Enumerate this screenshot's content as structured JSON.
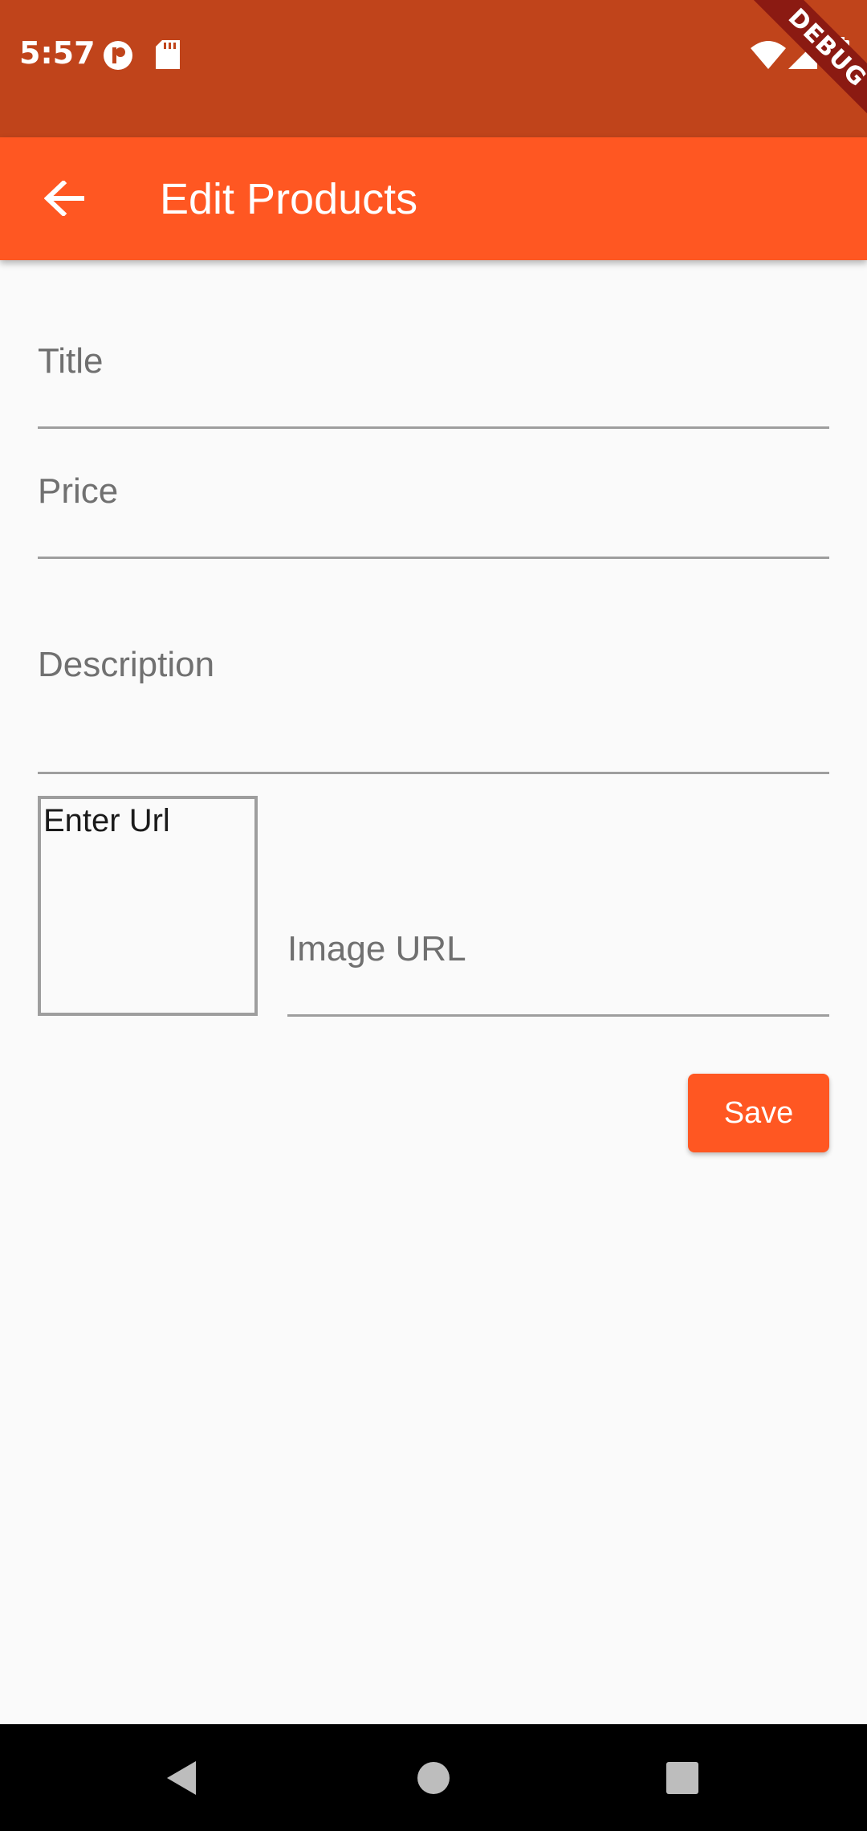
{
  "status_bar": {
    "time": "5:57",
    "badge_text": "DEBUG",
    "icons": [
      "app-notification-icon",
      "sd-card-icon",
      "wifi-icon",
      "signal-icon",
      "battery-icon"
    ],
    "background": "#C0441B"
  },
  "app_bar": {
    "title": "Edit Products",
    "back_icon": "arrow-left-icon",
    "background": "#FF5722"
  },
  "form": {
    "title_label": "Title",
    "price_label": "Price",
    "description_label": "Description",
    "image_url_label": "Image URL",
    "preview_placeholder": "Enter Url",
    "save_label": "Save"
  },
  "nav_bar": {
    "icons": [
      "back-triangle-icon",
      "home-circle-icon",
      "recents-square-icon"
    ]
  }
}
